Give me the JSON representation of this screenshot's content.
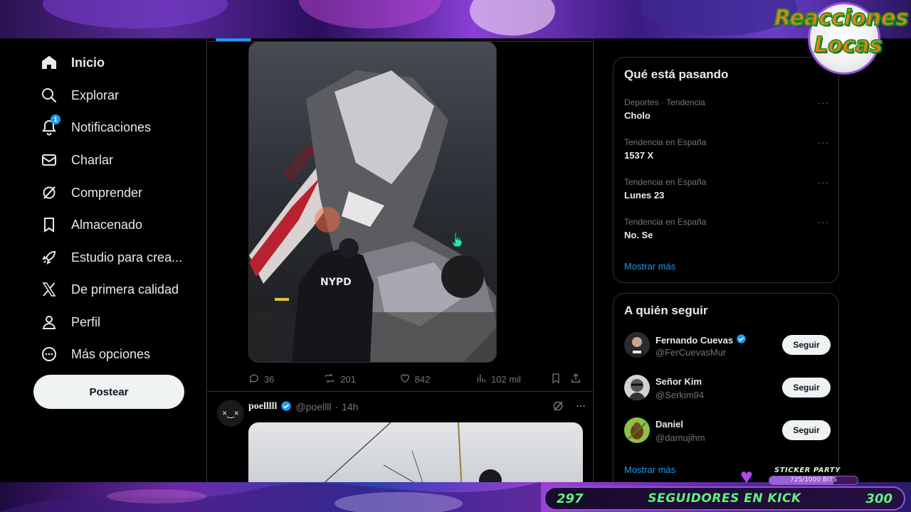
{
  "overlay": {
    "brand_line1": "Reacciones",
    "brand_line2": "Locas",
    "kick_current": "297",
    "kick_label": "SEGUIDORES EN KICK",
    "kick_goal": "300",
    "sticker_title": "STICKER PARTY",
    "sticker_progress_label": "725/1000 BITS",
    "sticker_progress": 0.725
  },
  "nav": {
    "items": [
      {
        "label": "Inicio",
        "icon": "home-icon"
      },
      {
        "label": "Explorar",
        "icon": "search-icon"
      },
      {
        "label": "Notificaciones",
        "icon": "bell-icon",
        "badge": "1"
      },
      {
        "label": "Charlar",
        "icon": "mail-icon"
      },
      {
        "label": "Comprender",
        "icon": "grok-icon"
      },
      {
        "label": "Almacenado",
        "icon": "bookmark-icon"
      },
      {
        "label": "Estudio para crea...",
        "icon": "rocket-icon"
      },
      {
        "label": "De primera calidad",
        "icon": "x-logo-icon"
      },
      {
        "label": "Perfil",
        "icon": "person-icon"
      },
      {
        "label": "Más opciones",
        "icon": "more-circle-icon"
      }
    ],
    "post_label": "Postear"
  },
  "feed": {
    "post1": {
      "media_text": "NYPD",
      "media_text2": "EXPRESS",
      "replies": "36",
      "reposts": "201",
      "likes": "842",
      "views": "102 mil"
    },
    "post2": {
      "avatar_text": "×‿×",
      "name": "poelllll",
      "handle": "@poellll",
      "dot": "·",
      "time": "14h"
    }
  },
  "trends": {
    "title": "Qué está pasando",
    "items": [
      {
        "meta": "Deportes · Tendencia",
        "topic": "Cholo"
      },
      {
        "meta": "Tendencia en España",
        "topic": "1537 X"
      },
      {
        "meta": "Tendencia en España",
        "topic": "Lunes 23"
      },
      {
        "meta": "Tendencia en España",
        "topic": "No. Se"
      }
    ],
    "more_glyph": "···",
    "show_more": "Mostrar más"
  },
  "who_to_follow": {
    "title": "A quién seguir",
    "items": [
      {
        "name": "Fernando Cuevas",
        "handle": "@FerCuevasMur",
        "verified": true,
        "follow": "Seguir"
      },
      {
        "name": "Señor Kim",
        "handle": "@Serkim94",
        "verified": false,
        "follow": "Seguir"
      },
      {
        "name": "Daniel",
        "handle": "@damujihm",
        "verified": false,
        "follow": "Seguir"
      }
    ],
    "show_more": "Mostrar más"
  },
  "colors": {
    "accent": "#1d9bf0",
    "background": "#000000",
    "border": "#2f3336",
    "muted": "#71767b",
    "kick_green": "#5ef27a",
    "overlay_purple": "#9a4fe0"
  }
}
